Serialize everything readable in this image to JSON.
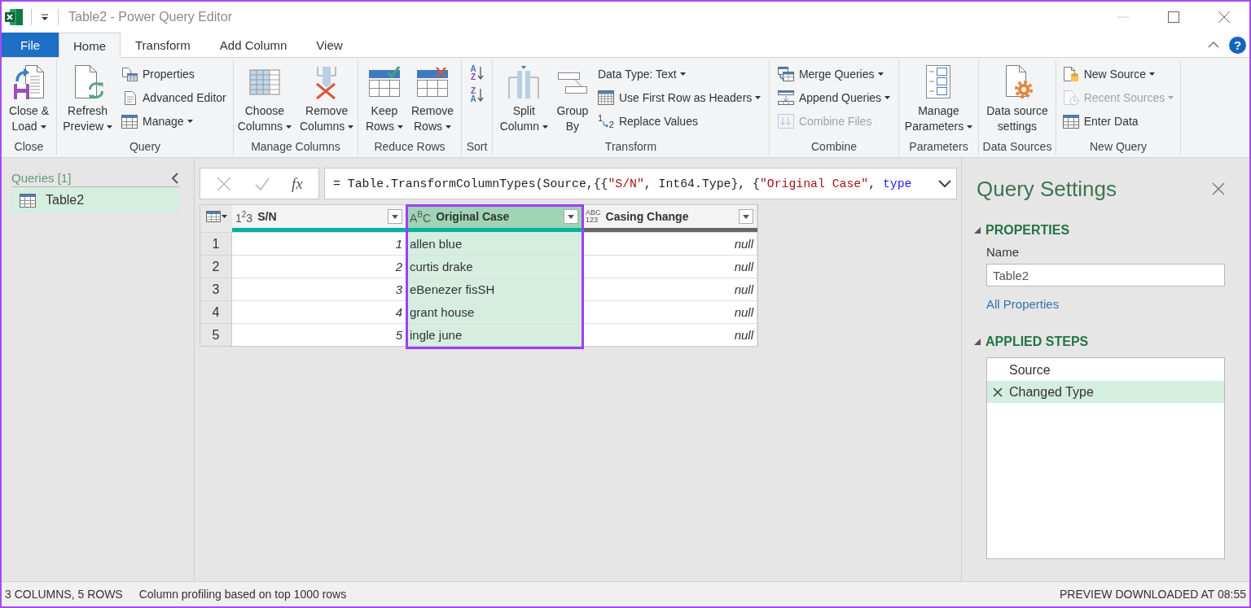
{
  "window": {
    "title": "Table2 - Power Query Editor"
  },
  "ribbon_tabs": [
    {
      "label": "File",
      "kind": "file",
      "selected": false
    },
    {
      "label": "Home",
      "kind": "tab",
      "selected": true
    },
    {
      "label": "Transform",
      "kind": "tab",
      "selected": false
    },
    {
      "label": "Add Column",
      "kind": "tab",
      "selected": false
    },
    {
      "label": "View",
      "kind": "tab",
      "selected": false
    }
  ],
  "help": {
    "label": "?"
  },
  "ribbon_groups": [
    {
      "label": "Close",
      "items": [
        {
          "kind": "large",
          "label_lines": [
            "Close &",
            "Load"
          ],
          "dropdown": true,
          "disabled": false
        }
      ]
    },
    {
      "label": "Query",
      "items": [
        {
          "kind": "large",
          "label_lines": [
            "Refresh",
            "Preview"
          ],
          "dropdown": true,
          "disabled": false
        },
        {
          "kind": "small",
          "label": "Properties",
          "dropdown": false,
          "disabled": false
        },
        {
          "kind": "small",
          "label": "Advanced Editor",
          "dropdown": false,
          "disabled": false
        },
        {
          "kind": "small",
          "label": "Manage",
          "dropdown": true,
          "disabled": false
        }
      ]
    },
    {
      "label": "Manage Columns",
      "items": [
        {
          "kind": "large",
          "label_lines": [
            "Choose",
            "Columns"
          ],
          "dropdown": true,
          "disabled": false
        },
        {
          "kind": "large",
          "label_lines": [
            "Remove",
            "Columns"
          ],
          "dropdown": true,
          "disabled": false
        }
      ]
    },
    {
      "label": "Reduce Rows",
      "items": [
        {
          "kind": "large",
          "label_lines": [
            "Keep",
            "Rows"
          ],
          "dropdown": true,
          "disabled": false
        },
        {
          "kind": "large",
          "label_lines": [
            "Remove",
            "Rows"
          ],
          "dropdown": true,
          "disabled": false
        }
      ]
    },
    {
      "label": "Sort",
      "items": [
        {
          "kind": "sort",
          "letters": [
            {
              "text": "A",
              "color": "#3b78c2"
            },
            {
              "text": "Z",
              "color": "#8a4db3"
            }
          ],
          "dropdown": false,
          "disabled": false
        },
        {
          "kind": "sort",
          "letters": [
            {
              "text": "Z",
              "color": "#8a4db3"
            },
            {
              "text": "A",
              "color": "#3b78c2"
            }
          ],
          "dropdown": false,
          "disabled": false
        }
      ]
    },
    {
      "label": "Transform",
      "items": [
        {
          "kind": "large",
          "label_lines": [
            "Split",
            "Column"
          ],
          "dropdown": true,
          "disabled": false
        },
        {
          "kind": "large",
          "label_lines": [
            "Group",
            "By"
          ],
          "dropdown": false,
          "disabled": false
        },
        {
          "kind": "small",
          "label": "Data Type: Text",
          "dropdown": true,
          "disabled": false
        },
        {
          "kind": "small",
          "label": "Use First Row as Headers",
          "dropdown": true,
          "disabled": false
        },
        {
          "kind": "small",
          "label": "Replace Values",
          "icon_digits": [
            "1",
            "2"
          ],
          "dropdown": false,
          "disabled": false
        }
      ]
    },
    {
      "label": "Combine",
      "items": [
        {
          "kind": "small",
          "label": "Merge Queries",
          "dropdown": true,
          "disabled": false
        },
        {
          "kind": "small",
          "label": "Append Queries",
          "dropdown": true,
          "disabled": false
        },
        {
          "kind": "small",
          "label": "Combine Files",
          "dropdown": false,
          "disabled": true
        }
      ]
    },
    {
      "label": "Parameters",
      "items": [
        {
          "kind": "large",
          "label_lines": [
            "Manage",
            "Parameters"
          ],
          "dropdown": true,
          "disabled": false
        }
      ]
    },
    {
      "label": "Data Sources",
      "items": [
        {
          "kind": "large",
          "label_lines": [
            "Data source",
            "settings"
          ],
          "dropdown": false,
          "disabled": false
        }
      ]
    },
    {
      "label": "New Query",
      "items": [
        {
          "kind": "small",
          "label": "New Source",
          "dropdown": true,
          "disabled": false
        },
        {
          "kind": "small",
          "label": "Recent Sources",
          "dropdown": true,
          "disabled": true
        },
        {
          "kind": "small",
          "label": "Enter Data",
          "dropdown": false,
          "disabled": false
        }
      ]
    }
  ],
  "queries_pane": {
    "title": "Queries [1]",
    "items": [
      {
        "label": "Table2",
        "selected": true
      }
    ]
  },
  "formula_bar": {
    "function_label": "fx",
    "tokens": [
      {
        "kind": "plain",
        "text": "= Table.TransformColumnTypes(Source,{{"
      },
      {
        "kind": "string",
        "text": "\"S/N\""
      },
      {
        "kind": "plain",
        "text": ", Int64.Type}, {"
      },
      {
        "kind": "string",
        "text": "\"Original Case\""
      },
      {
        "kind": "plain",
        "text": ", "
      },
      {
        "kind": "keyword",
        "text": "type"
      }
    ]
  },
  "table": {
    "columns": [
      {
        "type_label": [
          "1$^{2}$3"
        ],
        "name": "S/N",
        "kind": "number",
        "color": "#00b39e",
        "selected": false,
        "outlined": false
      },
      {
        "type_label": [
          "A$^{B}$C"
        ],
        "name": "Original Case",
        "kind": "text",
        "color": "#00b39e",
        "selected": true,
        "outlined": true
      },
      {
        "type_label": [
          "ABC",
          "123"
        ],
        "name": "Casing Change",
        "kind": "any",
        "color": "#666666",
        "selected": false,
        "outlined": false
      }
    ],
    "rows": [
      {
        "number": "1",
        "cells": [
          "1",
          "allen blue",
          "null"
        ]
      },
      {
        "number": "2",
        "cells": [
          "2",
          "curtis drake",
          "null"
        ]
      },
      {
        "number": "3",
        "cells": [
          "3",
          "eBenezer fisSH",
          "null"
        ]
      },
      {
        "number": "4",
        "cells": [
          "4",
          "grant house",
          "null"
        ]
      },
      {
        "number": "5",
        "cells": [
          "5",
          "ingle june",
          "null"
        ]
      }
    ]
  },
  "query_settings": {
    "title": "Query Settings",
    "properties_heading": "PROPERTIES",
    "name_label": "Name",
    "name_value": "Table2",
    "all_properties_link": "All Properties",
    "steps_heading": "APPLIED STEPS",
    "steps": [
      {
        "label": "Source",
        "selected": false
      },
      {
        "label": "Changed Type",
        "selected": true
      }
    ]
  },
  "status_bar": {
    "left": [
      "3 COLUMNS, 5 ROWS",
      "Column profiling based on top 1000 rows"
    ],
    "right": "PREVIEW DOWNLOADED AT 08:55"
  }
}
